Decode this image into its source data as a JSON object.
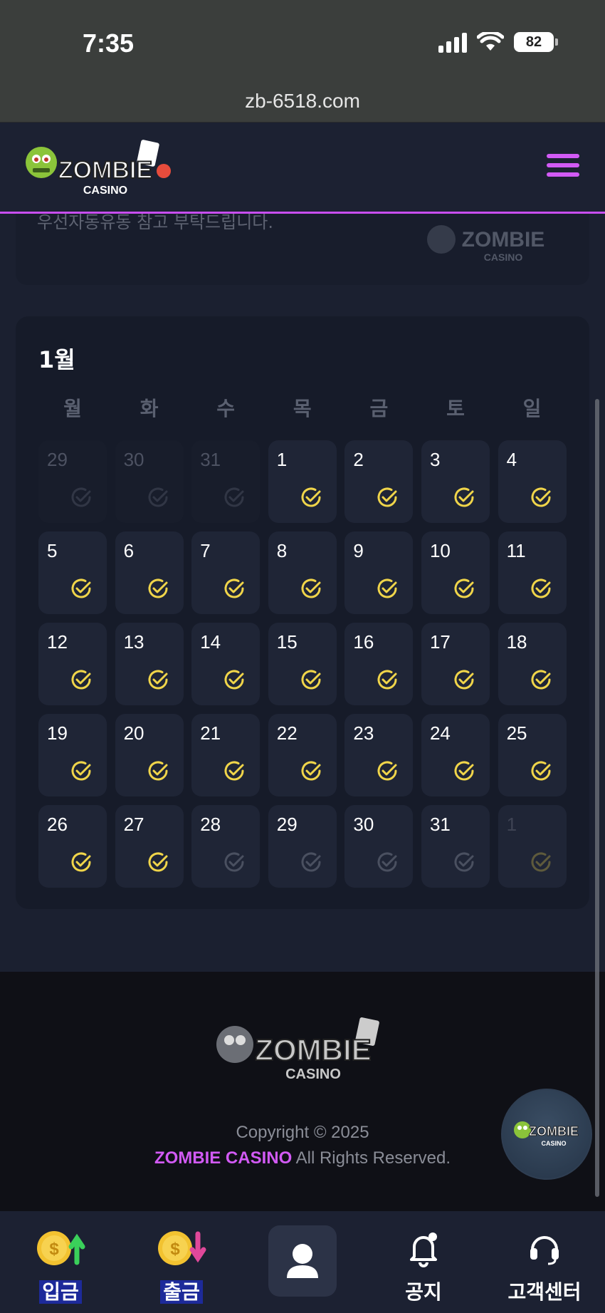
{
  "status_bar": {
    "time": "7:35",
    "battery": "82"
  },
  "browser": {
    "url": "zb-6518.com"
  },
  "header": {
    "logo_text_top": "ZOMBIE",
    "logo_text_bottom": "CASINO"
  },
  "banner": {
    "text": "우선자동유동 참고 부탁드립니다."
  },
  "calendar": {
    "month": "1월",
    "weekdays": [
      "월",
      "화",
      "수",
      "목",
      "금",
      "토",
      "일"
    ],
    "days": [
      {
        "n": "29",
        "state": "muted"
      },
      {
        "n": "30",
        "state": "muted"
      },
      {
        "n": "31",
        "state": "muted"
      },
      {
        "n": "1",
        "state": "checked"
      },
      {
        "n": "2",
        "state": "checked"
      },
      {
        "n": "3",
        "state": "checked"
      },
      {
        "n": "4",
        "state": "checked"
      },
      {
        "n": "5",
        "state": "checked"
      },
      {
        "n": "6",
        "state": "checked"
      },
      {
        "n": "7",
        "state": "checked"
      },
      {
        "n": "8",
        "state": "checked"
      },
      {
        "n": "9",
        "state": "checked"
      },
      {
        "n": "10",
        "state": "checked"
      },
      {
        "n": "11",
        "state": "checked"
      },
      {
        "n": "12",
        "state": "checked"
      },
      {
        "n": "13",
        "state": "checked"
      },
      {
        "n": "14",
        "state": "checked"
      },
      {
        "n": "15",
        "state": "checked"
      },
      {
        "n": "16",
        "state": "checked"
      },
      {
        "n": "17",
        "state": "checked"
      },
      {
        "n": "18",
        "state": "checked"
      },
      {
        "n": "19",
        "state": "checked"
      },
      {
        "n": "20",
        "state": "checked"
      },
      {
        "n": "21",
        "state": "checked"
      },
      {
        "n": "22",
        "state": "checked"
      },
      {
        "n": "23",
        "state": "checked"
      },
      {
        "n": "24",
        "state": "checked"
      },
      {
        "n": "25",
        "state": "checked"
      },
      {
        "n": "26",
        "state": "checked"
      },
      {
        "n": "27",
        "state": "checked"
      },
      {
        "n": "28",
        "state": "unchecked"
      },
      {
        "n": "29",
        "state": "unchecked"
      },
      {
        "n": "30",
        "state": "unchecked"
      },
      {
        "n": "31",
        "state": "unchecked"
      },
      {
        "n": "1",
        "state": "next"
      }
    ]
  },
  "footer": {
    "copyright": "Copyright © 2025",
    "brand": "ZOMBIE CASINO",
    "rights": " All Rights Reserved."
  },
  "bottom_nav": {
    "deposit": "입금",
    "withdraw": "출금",
    "notice": "공지",
    "support": "고객센터"
  },
  "colors": {
    "accent": "#d25af5",
    "check_active": "#f0d54a",
    "check_inactive": "#4a5060"
  }
}
